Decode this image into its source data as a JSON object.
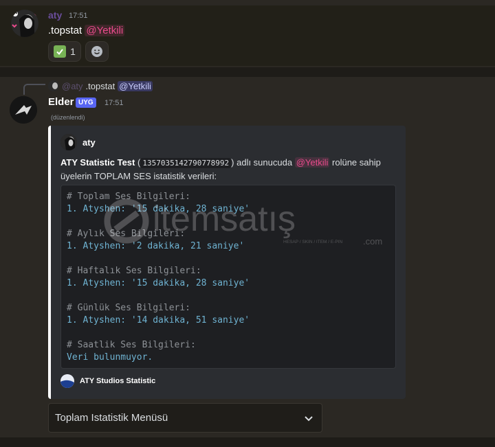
{
  "message1": {
    "username": "aty",
    "time": "17:51",
    "command": ".topstat",
    "mention": "@Yetkili",
    "reaction_count": "1"
  },
  "message2": {
    "reply": {
      "user": "@aty",
      "command": ".topstat",
      "mention": "@Yetkili"
    },
    "username": "Elder",
    "badge": "UYG",
    "time": "17:51",
    "edited": "(düzenlendi)",
    "embed": {
      "author": "aty",
      "desc_title": "ATY Statistic Test",
      "desc_open": " (",
      "guild_id": "1357035142790778992",
      "desc_mid": ") adlı sunucuda",
      "desc_mention": "@Yetkili",
      "desc_end": "rolüne sahip üyelerin TOPLAM SES istatistik verileri:",
      "code": {
        "h1": "# Toplam Ses Bilgileri:",
        "v1": "1. Atyshen: '15 dakika, 28 saniye'",
        "h2": "# Aylık Ses Bilgileri:",
        "v2": "1. Atyshen: '2 dakika, 21 saniye'",
        "h3": "# Haftalık Ses Bilgileri:",
        "v3": "1. Atyshen: '15 dakika, 28 saniye'",
        "h4": "# Günlük Ses Bilgileri:",
        "v4": "1. Atyshen: '14 dakika, 51 saniye'",
        "h5": "# Saatlik Ses Bilgileri:",
        "v5": "Veri bulunmuyor."
      },
      "footer": "ATY Studios Statistic"
    },
    "select_menu": {
      "label": "Toplam Istatistik Menüsü"
    }
  },
  "watermark": {
    "brand": "itemsatış",
    "tagline": "HESAP / SKIN / ITEM / E-PIN",
    "domain": ".com"
  },
  "colors": {
    "mention": "#e94b8c",
    "badge": "#5865f2",
    "code_value": "#6fb3d2",
    "check": "#77b255"
  }
}
